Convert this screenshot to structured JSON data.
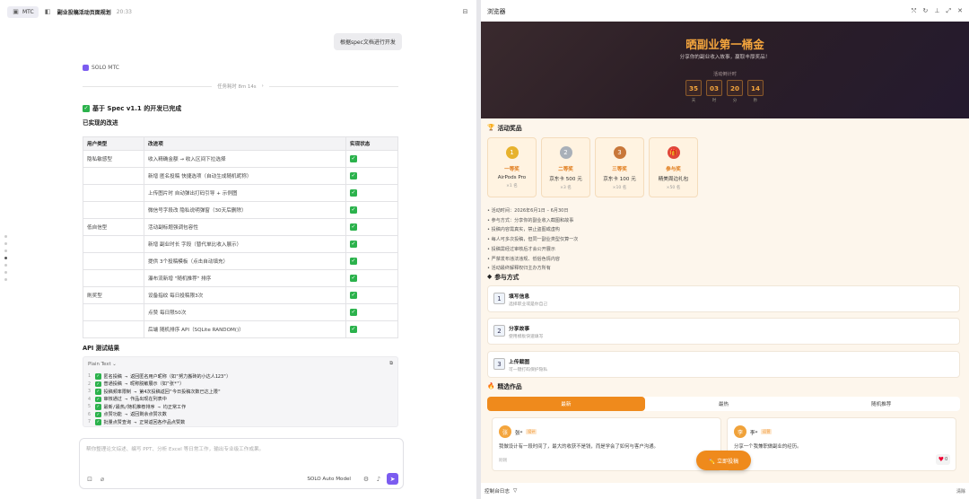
{
  "topbar": {
    "badge": "MTC",
    "title": "副业投稿活动页面规划",
    "time": "20:33"
  },
  "user_message": "根据spec文档进行开发",
  "assistant": {
    "name": "SOLO MTC",
    "task_time": "任务耗时 8m 14s",
    "heading": "基于 Spec v1.1 的开发已完成",
    "subheading": "已实现的改进"
  },
  "table": {
    "headers": [
      "用户类型",
      "改进项",
      "实现状态"
    ],
    "rows": [
      {
        "type": "隐私敏感型",
        "item": "收入精确金额 → 收入区间下拉选择"
      },
      {
        "type": "",
        "item": "新增 匿名投稿 快捷选项（自动生成随机昵称）"
      },
      {
        "type": "",
        "item": "上传图片时 自动弹出打码引导 + 示例图"
      },
      {
        "type": "",
        "item": "微信号字段改 隐私说明弹窗（30天后删除）"
      },
      {
        "type": "低自信型",
        "item": "活动副标题强调包容性"
      },
      {
        "type": "",
        "item": "新增 副业时长 字段（替代单比收入展示）"
      },
      {
        "type": "",
        "item": "提供 3个投稿模板（点击自动填充）"
      },
      {
        "type": "",
        "item": "瀑布流新增 \"随机推荐\" 排序"
      },
      {
        "type": "刷奖型",
        "item": "设备指纹 每日投稿限3次"
      },
      {
        "type": "",
        "item": "点赞 每日限50次"
      },
      {
        "type": "",
        "item": "后端 随机排序 API（SQLite RANDOM()）"
      }
    ]
  },
  "api": {
    "heading": "API 测试结果",
    "lang": "Plain Text",
    "lines": [
      "匿名投稿 → 返回匿名用户昵称（如\"努力搬砖的小达人123\"）",
      "普通投稿 → 昵称脱敏展示（如\"张*\"）",
      "投稿频率限制 → 第4次投稿返回\"今日投稿次数已达上限\"",
      "审核通过 → 作品出现在列表中",
      "最新/最热/随机推荐排序 → 均正常工作",
      "点赞功能 → 返回剩余点赞次数",
      "批量点赞查询 → 正常返回各作品点赞数"
    ]
  },
  "composer": {
    "placeholder": "帮你整理论文综述、编写 PPT、分析 Excel 等日常工作，输出专业级工作成果。",
    "model": "SOLO Auto Model"
  },
  "browser": {
    "title": "浏览器",
    "hero_title": "晒副业第一桶金",
    "hero_sub": "分享你的副业收入故事，赢取丰厚奖品！",
    "countdown_label": "活动倒计时",
    "countdown": [
      {
        "v": "35",
        "u": "天"
      },
      {
        "v": "03",
        "u": "时"
      },
      {
        "v": "20",
        "u": "分"
      },
      {
        "v": "14",
        "u": "秒"
      }
    ],
    "prizes_title": "活动奖品",
    "prizes": [
      {
        "rank": "一等奖",
        "gift": "AirPods Pro",
        "count": "×1 名",
        "icon": "1",
        "color": "#e7b22d"
      },
      {
        "rank": "二等奖",
        "gift": "京东卡 500 元",
        "count": "×3 名",
        "icon": "2",
        "color": "#a9b0b9"
      },
      {
        "rank": "三等奖",
        "gift": "京东卡 100 元",
        "count": "×10 名",
        "icon": "3",
        "color": "#c8773a"
      },
      {
        "rank": "参与奖",
        "gift": "精美周边礼包",
        "count": "×50 名",
        "icon": "🎁",
        "color": "#e0463a"
      }
    ],
    "rules": [
      "• 活动时间：2026年6月1日 – 6月30日",
      "• 参与方式：分享你的副业收入截图和故事",
      "• 投稿内容需真实，禁止盗图或虚构",
      "• 每人可多次投稿，但同一副业类型仅算一次",
      "• 投稿需经过审核后才会公开展示",
      "• 严禁发布违法违规、低俗色情内容",
      "• 活动最终解释权归主办方所有"
    ],
    "steps_title": "参与方式",
    "steps": [
      {
        "num": "1",
        "title": "填写信息",
        "desc": "选择职业或是你自己"
      },
      {
        "num": "2",
        "title": "分享故事",
        "desc": "使用模板快速填写"
      },
      {
        "num": "3",
        "title": "上传截图",
        "desc": "可一键打码保护隐私"
      }
    ],
    "works_title": "精选作品",
    "tabs": [
      "最新",
      "最热",
      "随机推荐"
    ],
    "cards": [
      {
        "avatar": "张",
        "name": "张*",
        "tag": "设计",
        "text": "我做设计有一段时间了，最大的收获不是钱，而是学会了如何与客户沟通。",
        "time": "刚刚",
        "likes": ""
      },
      {
        "avatar": "李",
        "name": "李*",
        "tag": "运营",
        "text": "分享一个我兼职做副业的经历。",
        "time": "",
        "likes": "0"
      }
    ],
    "fab": "✏️ 立即投稿",
    "bottom": {
      "console": "控制台日志",
      "clear": "清除"
    }
  }
}
